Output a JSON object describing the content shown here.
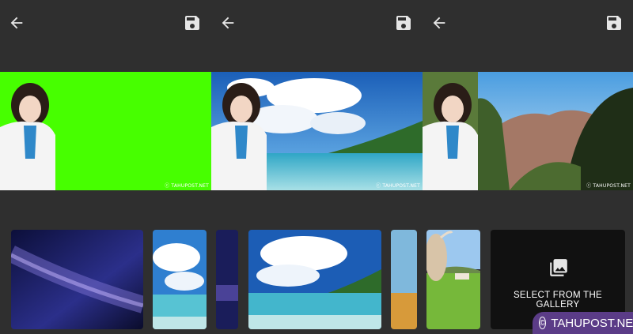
{
  "toolbar": {
    "back_icon": "arrow-left-icon",
    "save_icon": "floppy-disk-icon"
  },
  "previews": [
    {
      "background": "green-screen",
      "watermark": "ⓒ TAHUPOST.NET"
    },
    {
      "background": "beach",
      "watermark": "ⓒ TAHUPOST.NET"
    },
    {
      "background": "mountains",
      "watermark": "ⓒ TAHUPOST.NET"
    }
  ],
  "thumbnails": [
    {
      "name": "night-sky"
    },
    {
      "name": "beach-clouds"
    },
    {
      "name": "night-sky-partial"
    },
    {
      "name": "beach"
    },
    {
      "name": "sky-field-partial"
    },
    {
      "name": "cow-field"
    }
  ],
  "gallery": {
    "label": "SELECT FROM THE GALLERY",
    "icon": "photo-library-icon"
  },
  "watermark": {
    "symbol": "©",
    "text": "TAHUPOST.NET"
  },
  "colors": {
    "background": "#2f2f2f",
    "green_screen": "#47ff00",
    "badge": "#5b3c87"
  }
}
